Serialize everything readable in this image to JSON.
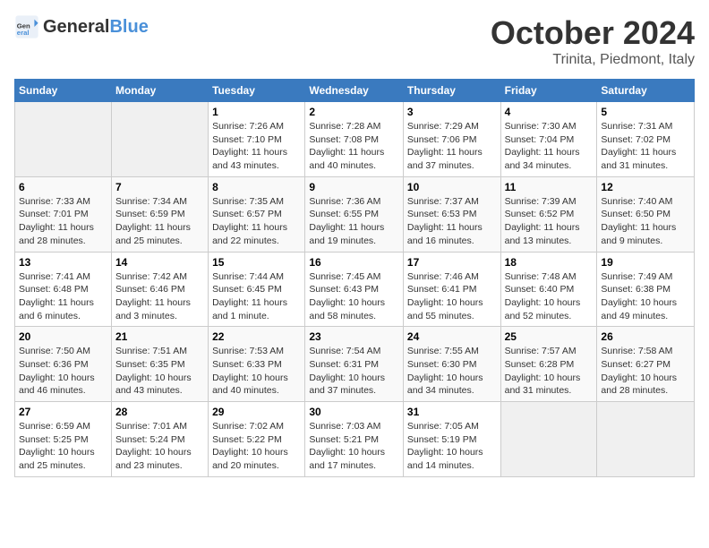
{
  "header": {
    "logo_general": "General",
    "logo_blue": "Blue",
    "month": "October 2024",
    "location": "Trinita, Piedmont, Italy"
  },
  "weekdays": [
    "Sunday",
    "Monday",
    "Tuesday",
    "Wednesday",
    "Thursday",
    "Friday",
    "Saturday"
  ],
  "weeks": [
    [
      {
        "day": "",
        "sunrise": "",
        "sunset": "",
        "daylight": ""
      },
      {
        "day": "",
        "sunrise": "",
        "sunset": "",
        "daylight": ""
      },
      {
        "day": "1",
        "sunrise": "Sunrise: 7:26 AM",
        "sunset": "Sunset: 7:10 PM",
        "daylight": "Daylight: 11 hours and 43 minutes."
      },
      {
        "day": "2",
        "sunrise": "Sunrise: 7:28 AM",
        "sunset": "Sunset: 7:08 PM",
        "daylight": "Daylight: 11 hours and 40 minutes."
      },
      {
        "day": "3",
        "sunrise": "Sunrise: 7:29 AM",
        "sunset": "Sunset: 7:06 PM",
        "daylight": "Daylight: 11 hours and 37 minutes."
      },
      {
        "day": "4",
        "sunrise": "Sunrise: 7:30 AM",
        "sunset": "Sunset: 7:04 PM",
        "daylight": "Daylight: 11 hours and 34 minutes."
      },
      {
        "day": "5",
        "sunrise": "Sunrise: 7:31 AM",
        "sunset": "Sunset: 7:02 PM",
        "daylight": "Daylight: 11 hours and 31 minutes."
      }
    ],
    [
      {
        "day": "6",
        "sunrise": "Sunrise: 7:33 AM",
        "sunset": "Sunset: 7:01 PM",
        "daylight": "Daylight: 11 hours and 28 minutes."
      },
      {
        "day": "7",
        "sunrise": "Sunrise: 7:34 AM",
        "sunset": "Sunset: 6:59 PM",
        "daylight": "Daylight: 11 hours and 25 minutes."
      },
      {
        "day": "8",
        "sunrise": "Sunrise: 7:35 AM",
        "sunset": "Sunset: 6:57 PM",
        "daylight": "Daylight: 11 hours and 22 minutes."
      },
      {
        "day": "9",
        "sunrise": "Sunrise: 7:36 AM",
        "sunset": "Sunset: 6:55 PM",
        "daylight": "Daylight: 11 hours and 19 minutes."
      },
      {
        "day": "10",
        "sunrise": "Sunrise: 7:37 AM",
        "sunset": "Sunset: 6:53 PM",
        "daylight": "Daylight: 11 hours and 16 minutes."
      },
      {
        "day": "11",
        "sunrise": "Sunrise: 7:39 AM",
        "sunset": "Sunset: 6:52 PM",
        "daylight": "Daylight: 11 hours and 13 minutes."
      },
      {
        "day": "12",
        "sunrise": "Sunrise: 7:40 AM",
        "sunset": "Sunset: 6:50 PM",
        "daylight": "Daylight: 11 hours and 9 minutes."
      }
    ],
    [
      {
        "day": "13",
        "sunrise": "Sunrise: 7:41 AM",
        "sunset": "Sunset: 6:48 PM",
        "daylight": "Daylight: 11 hours and 6 minutes."
      },
      {
        "day": "14",
        "sunrise": "Sunrise: 7:42 AM",
        "sunset": "Sunset: 6:46 PM",
        "daylight": "Daylight: 11 hours and 3 minutes."
      },
      {
        "day": "15",
        "sunrise": "Sunrise: 7:44 AM",
        "sunset": "Sunset: 6:45 PM",
        "daylight": "Daylight: 11 hours and 1 minute."
      },
      {
        "day": "16",
        "sunrise": "Sunrise: 7:45 AM",
        "sunset": "Sunset: 6:43 PM",
        "daylight": "Daylight: 10 hours and 58 minutes."
      },
      {
        "day": "17",
        "sunrise": "Sunrise: 7:46 AM",
        "sunset": "Sunset: 6:41 PM",
        "daylight": "Daylight: 10 hours and 55 minutes."
      },
      {
        "day": "18",
        "sunrise": "Sunrise: 7:48 AM",
        "sunset": "Sunset: 6:40 PM",
        "daylight": "Daylight: 10 hours and 52 minutes."
      },
      {
        "day": "19",
        "sunrise": "Sunrise: 7:49 AM",
        "sunset": "Sunset: 6:38 PM",
        "daylight": "Daylight: 10 hours and 49 minutes."
      }
    ],
    [
      {
        "day": "20",
        "sunrise": "Sunrise: 7:50 AM",
        "sunset": "Sunset: 6:36 PM",
        "daylight": "Daylight: 10 hours and 46 minutes."
      },
      {
        "day": "21",
        "sunrise": "Sunrise: 7:51 AM",
        "sunset": "Sunset: 6:35 PM",
        "daylight": "Daylight: 10 hours and 43 minutes."
      },
      {
        "day": "22",
        "sunrise": "Sunrise: 7:53 AM",
        "sunset": "Sunset: 6:33 PM",
        "daylight": "Daylight: 10 hours and 40 minutes."
      },
      {
        "day": "23",
        "sunrise": "Sunrise: 7:54 AM",
        "sunset": "Sunset: 6:31 PM",
        "daylight": "Daylight: 10 hours and 37 minutes."
      },
      {
        "day": "24",
        "sunrise": "Sunrise: 7:55 AM",
        "sunset": "Sunset: 6:30 PM",
        "daylight": "Daylight: 10 hours and 34 minutes."
      },
      {
        "day": "25",
        "sunrise": "Sunrise: 7:57 AM",
        "sunset": "Sunset: 6:28 PM",
        "daylight": "Daylight: 10 hours and 31 minutes."
      },
      {
        "day": "26",
        "sunrise": "Sunrise: 7:58 AM",
        "sunset": "Sunset: 6:27 PM",
        "daylight": "Daylight: 10 hours and 28 minutes."
      }
    ],
    [
      {
        "day": "27",
        "sunrise": "Sunrise: 6:59 AM",
        "sunset": "Sunset: 5:25 PM",
        "daylight": "Daylight: 10 hours and 25 minutes."
      },
      {
        "day": "28",
        "sunrise": "Sunrise: 7:01 AM",
        "sunset": "Sunset: 5:24 PM",
        "daylight": "Daylight: 10 hours and 23 minutes."
      },
      {
        "day": "29",
        "sunrise": "Sunrise: 7:02 AM",
        "sunset": "Sunset: 5:22 PM",
        "daylight": "Daylight: 10 hours and 20 minutes."
      },
      {
        "day": "30",
        "sunrise": "Sunrise: 7:03 AM",
        "sunset": "Sunset: 5:21 PM",
        "daylight": "Daylight: 10 hours and 17 minutes."
      },
      {
        "day": "31",
        "sunrise": "Sunrise: 7:05 AM",
        "sunset": "Sunset: 5:19 PM",
        "daylight": "Daylight: 10 hours and 14 minutes."
      },
      {
        "day": "",
        "sunrise": "",
        "sunset": "",
        "daylight": ""
      },
      {
        "day": "",
        "sunrise": "",
        "sunset": "",
        "daylight": ""
      }
    ]
  ]
}
